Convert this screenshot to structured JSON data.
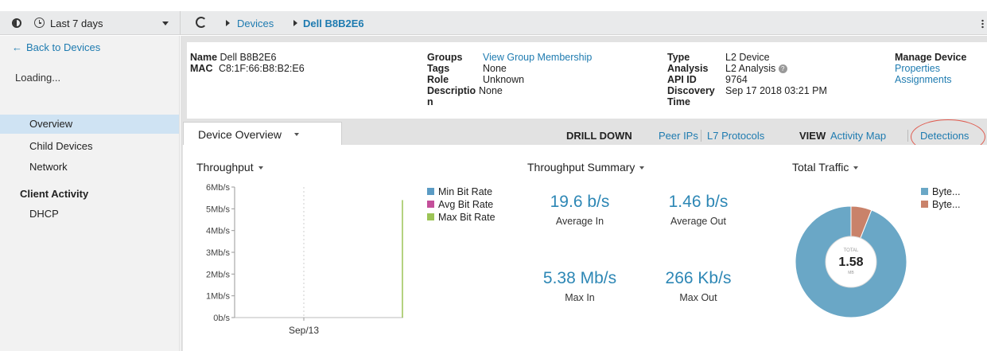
{
  "toolbar": {
    "time_range": "Last 7 days",
    "breadcrumb_devices": "Devices",
    "breadcrumb_current": "Dell B8B2E6"
  },
  "sidebar": {
    "back": "Back to Devices",
    "loading": "Loading...",
    "items": [
      {
        "label": "Overview"
      },
      {
        "label": "Child Devices"
      },
      {
        "label": "Network"
      }
    ],
    "section": "Client Activity",
    "section_items": [
      {
        "label": "DHCP"
      }
    ]
  },
  "info": {
    "name_label": "Name",
    "name_value": "Dell B8B2E6",
    "mac_label": "MAC",
    "mac_value": "C8:1F:66:B8:B2:E6",
    "groups_label": "Groups",
    "groups_value": "View Group Membership",
    "tags_label": "Tags",
    "tags_value": "None",
    "role_label": "Role",
    "role_value": "Unknown",
    "desc_label_1": "Descriptio",
    "desc_label_2": "n",
    "desc_value": "None",
    "type_label": "Type",
    "type_value": "L2 Device",
    "analysis_label": "Analysis",
    "analysis_value": "L2 Analysis",
    "apiid_label": "API ID",
    "apiid_value": "9764",
    "disc_label_1": "Discovery",
    "disc_label_2": "Time",
    "disc_value": "Sep 17 2018 03:21 PM",
    "manage_label": "Manage Device",
    "manage_properties": "Properties",
    "manage_assignments": "Assignments"
  },
  "tabs": {
    "overview_tab": "Device Overview",
    "drill_label": "DRILL DOWN",
    "peer_ips": "Peer IPs",
    "l7": "L7 Protocols",
    "view_label": "VIEW",
    "activity_map": "Activity Map",
    "detections": "Detections"
  },
  "throughput": {
    "title": "Throughput",
    "legend": [
      "Min Bit Rate",
      "Avg Bit Rate",
      "Max Bit Rate"
    ],
    "legend_colors": [
      "#5b9bc4",
      "#c44f9a",
      "#9cc456"
    ]
  },
  "summary": {
    "title": "Throughput Summary",
    "avg_in": "19.6 b/s",
    "avg_in_label": "Average In",
    "avg_out": "1.46 b/s",
    "avg_out_label": "Average Out",
    "max_in": "5.38 Mb/s",
    "max_in_label": "Max In",
    "max_out": "266 Kb/s",
    "max_out_label": "Max Out"
  },
  "traffic": {
    "title": "Total Traffic",
    "center_top": "TOTAL",
    "center_value": "1.58",
    "center_unit": "MB",
    "legend": [
      "Byte...",
      "Byte..."
    ],
    "legend_colors": [
      "#6aa7c6",
      "#c9826a"
    ]
  },
  "chart_data": [
    {
      "type": "line",
      "title": "Throughput",
      "x_ticks": [
        "Sep/13"
      ],
      "y_ticks": [
        "0b/s",
        "1Mb/s",
        "2Mb/s",
        "3Mb/s",
        "4Mb/s",
        "5Mb/s",
        "6Mb/s"
      ],
      "ylim": [
        0,
        6
      ],
      "ylabel_unit": "Mb/s",
      "series": [
        {
          "name": "Max Bit Rate",
          "points": [
            {
              "x": "end",
              "y": 5.4
            }
          ]
        }
      ]
    },
    {
      "type": "pie",
      "title": "Total Traffic",
      "total": "1.58 MB",
      "slices": [
        {
          "name": "Byte...",
          "value": 94
        },
        {
          "name": "Byte...",
          "value": 6
        }
      ]
    }
  ]
}
